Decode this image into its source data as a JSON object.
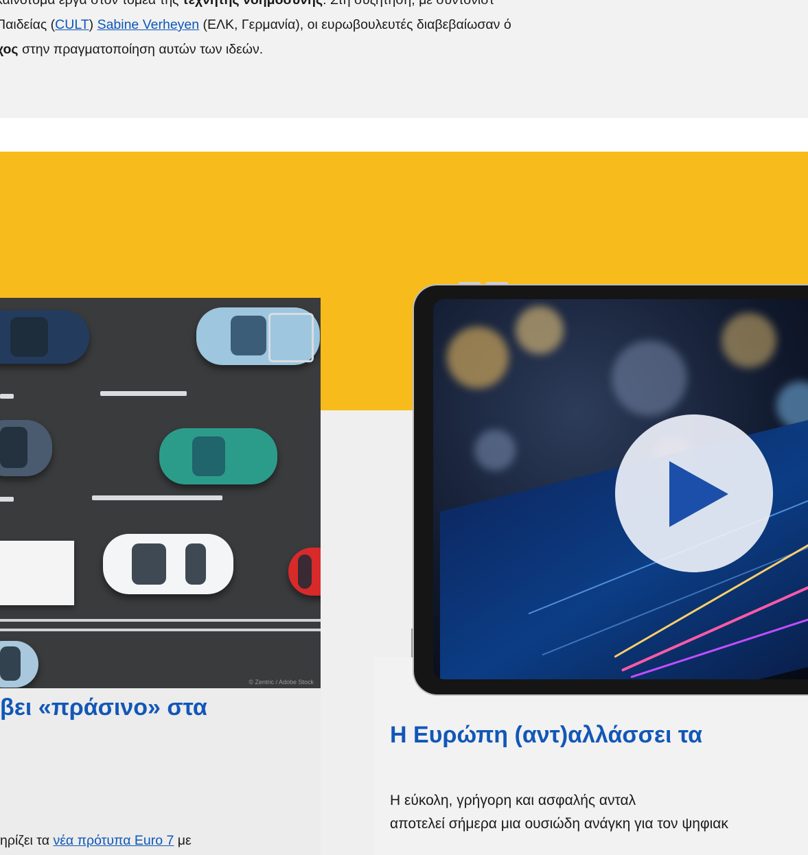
{
  "intro": {
    "line1_a": "καινοτόμα έργα στον τομέα της ",
    "line1_bold": "τεχνητής νοημοσύνης",
    "line1_b": ". Στη συζήτηση, με συντονίστ",
    "line2_a": "Παιδείας (",
    "line2_link1": "CULT",
    "line2_b": ") ",
    "line2_link2": "Sabine Verheyen",
    "line2_c": " (ΕΛΚ, Γερμανία), οι ευρωβουλευτές διαβεβαίωσαν ό",
    "line3_bold": "χος",
    "line3_a": " στην πραγματοποίηση αυτών των ιδεών."
  },
  "left_card": {
    "image_credit": "© Zentric / Adobe Stock",
    "title": "βει «πράσινο» στα",
    "text_a": "ηρίζει τα ",
    "text_link": "νέα πρότυπα Euro 7",
    "text_b": " με"
  },
  "right_card": {
    "play_icon": "play-icon",
    "title": "Η Ευρώπη (αντ)αλλάσσει τα ",
    "text_line1": "Η εύκολη, γρήγορη και ασφαλής ανταλ",
    "text_line2": "αποτελεί σήμερα μια ουσιώδη ανάγκη για τον ψηφιακ"
  },
  "colors": {
    "accent_yellow": "#f7bc1b",
    "title_blue": "#1257b7",
    "link_blue": "#0b56b8",
    "play_blue": "#1b4faa"
  }
}
